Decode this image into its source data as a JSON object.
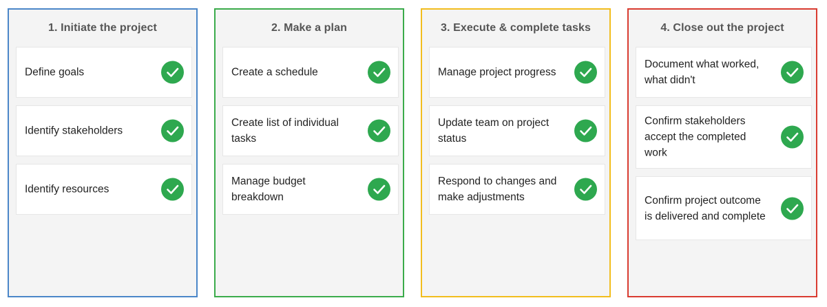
{
  "columns": [
    {
      "title": "1. Initiate the project",
      "border_color": "#4a86c8",
      "cards": [
        {
          "text": "Define goals",
          "icon": "check-circle-icon",
          "status_color": "#2ea84f"
        },
        {
          "text": "Identify stakeholders",
          "icon": "check-circle-icon",
          "status_color": "#2ea84f"
        },
        {
          "text": "Identify resources",
          "icon": "check-circle-icon",
          "status_color": "#2ea84f"
        }
      ]
    },
    {
      "title": "2. Make a plan",
      "border_color": "#3aab4a",
      "cards": [
        {
          "text": "Create a schedule",
          "icon": "check-circle-icon",
          "status_color": "#2ea84f"
        },
        {
          "text": "Create list of individual tasks",
          "icon": "check-circle-icon",
          "status_color": "#2ea84f"
        },
        {
          "text": "Manage budget breakdown",
          "icon": "check-circle-icon",
          "status_color": "#2ea84f"
        }
      ]
    },
    {
      "title": "3. Execute & complete tasks",
      "border_color": "#f2bd1d",
      "cards": [
        {
          "text": "Manage project progress",
          "icon": "check-circle-icon",
          "status_color": "#2ea84f"
        },
        {
          "text": "Update team on project status",
          "icon": "check-circle-icon",
          "status_color": "#2ea84f"
        },
        {
          "text": "Respond to changes and make adjustments",
          "icon": "check-circle-icon",
          "status_color": "#2ea84f"
        }
      ]
    },
    {
      "title": "4. Close out the project",
      "border_color": "#d93b30",
      "cards": [
        {
          "text": "Document what worked, what didn't",
          "icon": "check-circle-icon",
          "status_color": "#2ea84f"
        },
        {
          "text": "Confirm stakeholders accept the completed work",
          "icon": "check-circle-icon",
          "status_color": "#2ea84f"
        },
        {
          "text": "Confirm project outcome is delivered and complete",
          "icon": "check-circle-icon",
          "status_color": "#2ea84f"
        }
      ]
    }
  ]
}
